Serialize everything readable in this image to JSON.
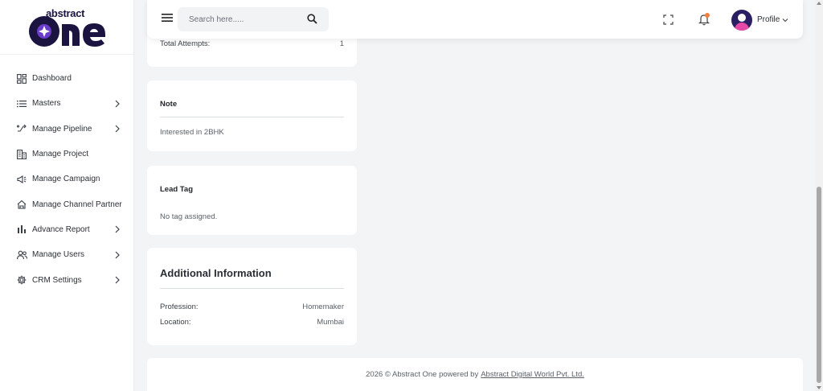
{
  "brand": {
    "top_word": "abstract",
    "logo_word": "one",
    "colors": {
      "navy": "#1b1340",
      "accent": "#6a3cc9"
    }
  },
  "sidebar": {
    "items": [
      {
        "label": "Dashboard",
        "icon": "dashboard-icon",
        "has_submenu": false
      },
      {
        "label": "Masters",
        "icon": "list-icon",
        "has_submenu": true
      },
      {
        "label": "Manage Pipeline",
        "icon": "pipeline-icon",
        "has_submenu": true
      },
      {
        "label": "Manage Project",
        "icon": "building-icon",
        "has_submenu": false
      },
      {
        "label": "Manage Campaign",
        "icon": "megaphone-icon",
        "has_submenu": false
      },
      {
        "label": "Manage Channel Partner",
        "icon": "partner-icon",
        "has_submenu": false
      },
      {
        "label": "Advance Report",
        "icon": "bar-chart-icon",
        "has_submenu": true
      },
      {
        "label": "Manage Users",
        "icon": "users-icon",
        "has_submenu": true
      },
      {
        "label": "CRM Settings",
        "icon": "gear-icon",
        "has_submenu": true
      }
    ]
  },
  "topbar": {
    "search_placeholder": "Search here.....",
    "profile_label": "Profile",
    "notification_dot_color": "#f47c3c"
  },
  "attempts": {
    "label": "Total Attempts:",
    "value": "1"
  },
  "note": {
    "title": "Note",
    "text": "Interested in 2BHK"
  },
  "lead_tag": {
    "title": "Lead Tag",
    "text": "No tag assigned."
  },
  "additional_info": {
    "title": "Additional Information",
    "rows": [
      {
        "label": "Profession:",
        "value": "Homemaker"
      },
      {
        "label": "Location:",
        "value": "Mumbai"
      }
    ]
  },
  "footer": {
    "text": "2026 © Abstract One powered by",
    "link_text": "Abstract Digital World Pvt. Ltd."
  }
}
